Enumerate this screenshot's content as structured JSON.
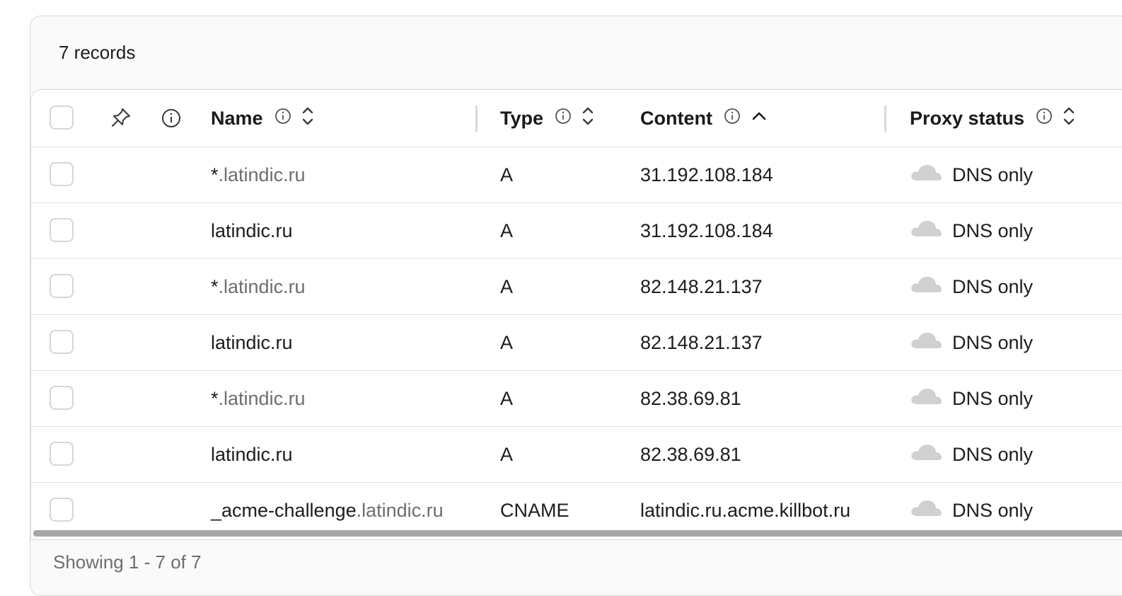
{
  "summary": {
    "records_label": "7 records"
  },
  "table": {
    "columns": {
      "name": "Name",
      "type": "Type",
      "content": "Content",
      "proxy": "Proxy status"
    },
    "sort": {
      "column": "Content",
      "direction": "ascending"
    },
    "rows": [
      {
        "name_prefix": "*",
        "name_domain": ".latindic.ru",
        "type": "A",
        "content": "31.192.108.184",
        "proxy": "DNS only"
      },
      {
        "name_prefix": "latindic.ru",
        "name_domain": "",
        "type": "A",
        "content": "31.192.108.184",
        "proxy": "DNS only"
      },
      {
        "name_prefix": "*",
        "name_domain": ".latindic.ru",
        "type": "A",
        "content": "82.148.21.137",
        "proxy": "DNS only"
      },
      {
        "name_prefix": "latindic.ru",
        "name_domain": "",
        "type": "A",
        "content": "82.148.21.137",
        "proxy": "DNS only"
      },
      {
        "name_prefix": "*",
        "name_domain": ".latindic.ru",
        "type": "A",
        "content": "82.38.69.81",
        "proxy": "DNS only"
      },
      {
        "name_prefix": "latindic.ru",
        "name_domain": "",
        "type": "A",
        "content": "82.38.69.81",
        "proxy": "DNS only"
      },
      {
        "name_prefix": "_acme-challenge",
        "name_domain": ".latindic.ru",
        "type": "CNAME",
        "content": "latindic.ru.acme.killbot.ru",
        "proxy": "DNS only"
      }
    ]
  },
  "pagination": {
    "label": "Showing 1 - 7 of 7"
  },
  "icons": {
    "pin": "pin-icon",
    "info": "info-icon",
    "sort": "sort-icon",
    "sort_up": "sort-ascending-icon",
    "cloud": "cloud-icon"
  },
  "colors": {
    "cloud_dns_only": "#d0d0d0",
    "muted_text": "#6e6e6e"
  }
}
